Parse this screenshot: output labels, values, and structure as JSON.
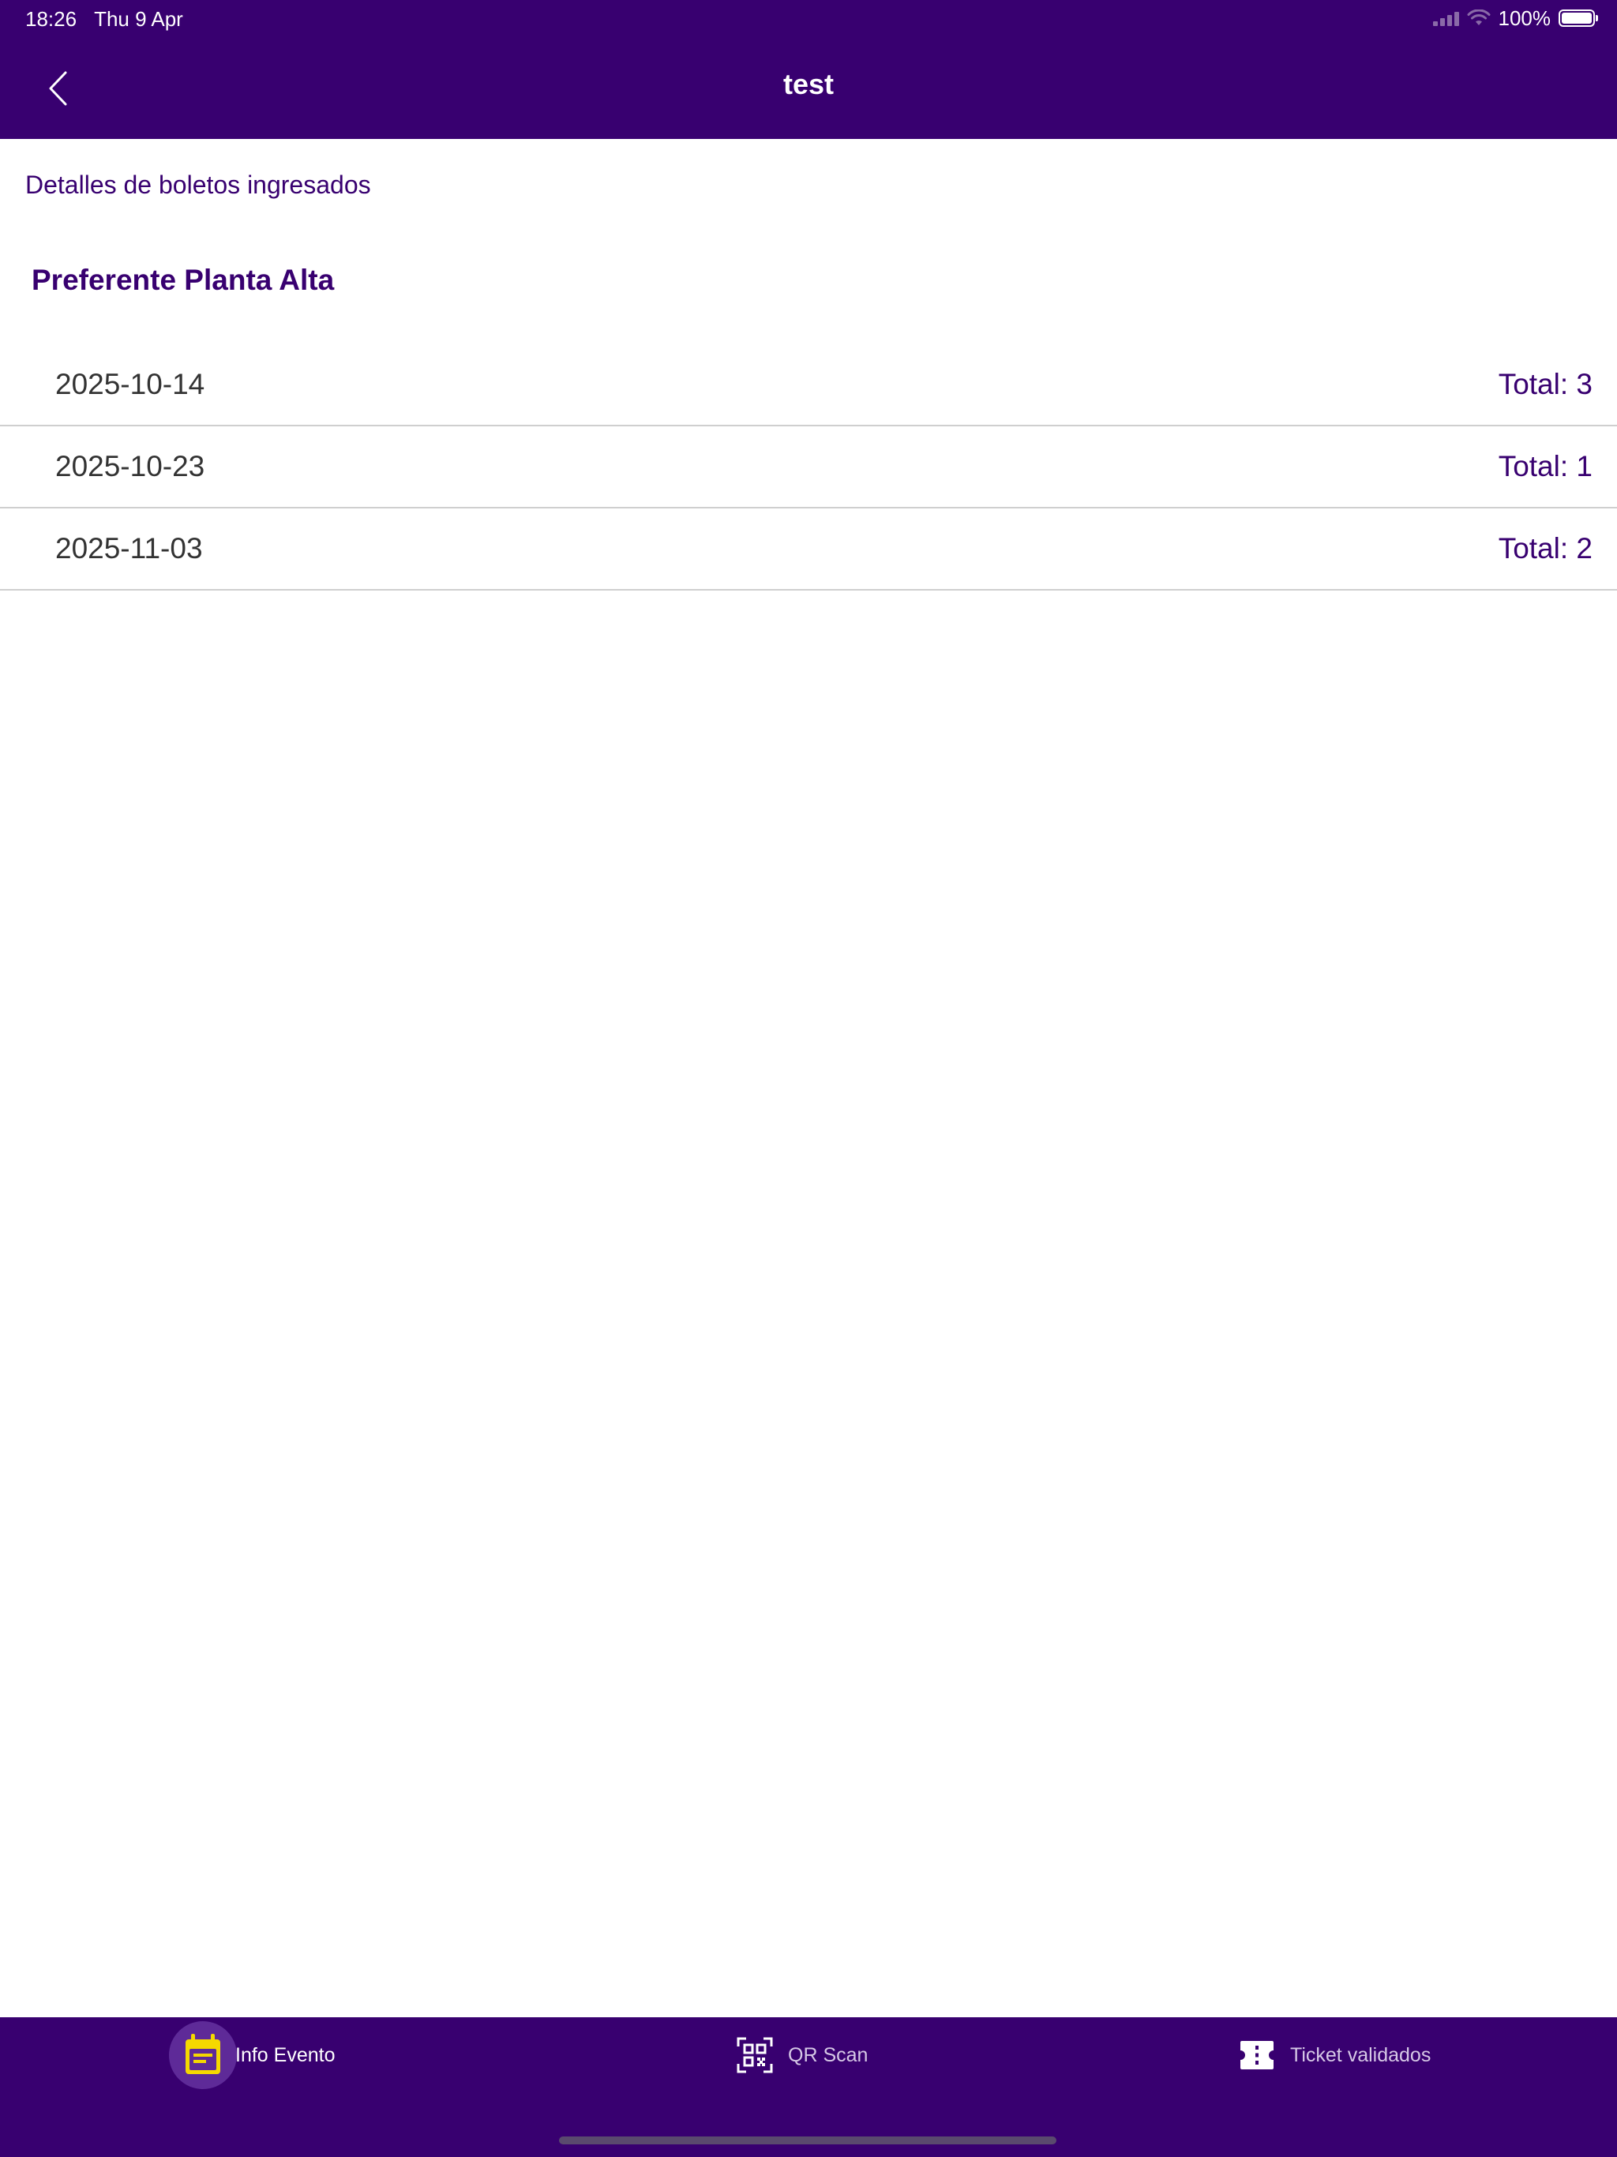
{
  "status_bar": {
    "time": "18:26",
    "date": "Thu 9 Apr",
    "battery": "100%"
  },
  "nav": {
    "title": "test",
    "back_icon": "chevron-left-icon"
  },
  "content": {
    "subtitle": "Detalles de boletos ingresados",
    "group_title": "Preferente Planta Alta",
    "rows": [
      {
        "date": "2025-10-14",
        "total": "Total: 3"
      },
      {
        "date": "2025-10-23",
        "total": "Total: 1"
      },
      {
        "date": "2025-11-03",
        "total": "Total: 2"
      }
    ]
  },
  "tabbar": {
    "tabs": [
      {
        "label": "Info Evento",
        "icon": "calendar-event-icon",
        "active": true
      },
      {
        "label": "QR Scan",
        "icon": "qr-scan-icon",
        "active": false
      },
      {
        "label": "Ticket validados",
        "icon": "ticket-icon",
        "active": false
      }
    ]
  },
  "colors": {
    "brand_purple": "#380070",
    "active_icon_yellow": "#f5d800",
    "active_bubble": "#5e2a98"
  }
}
